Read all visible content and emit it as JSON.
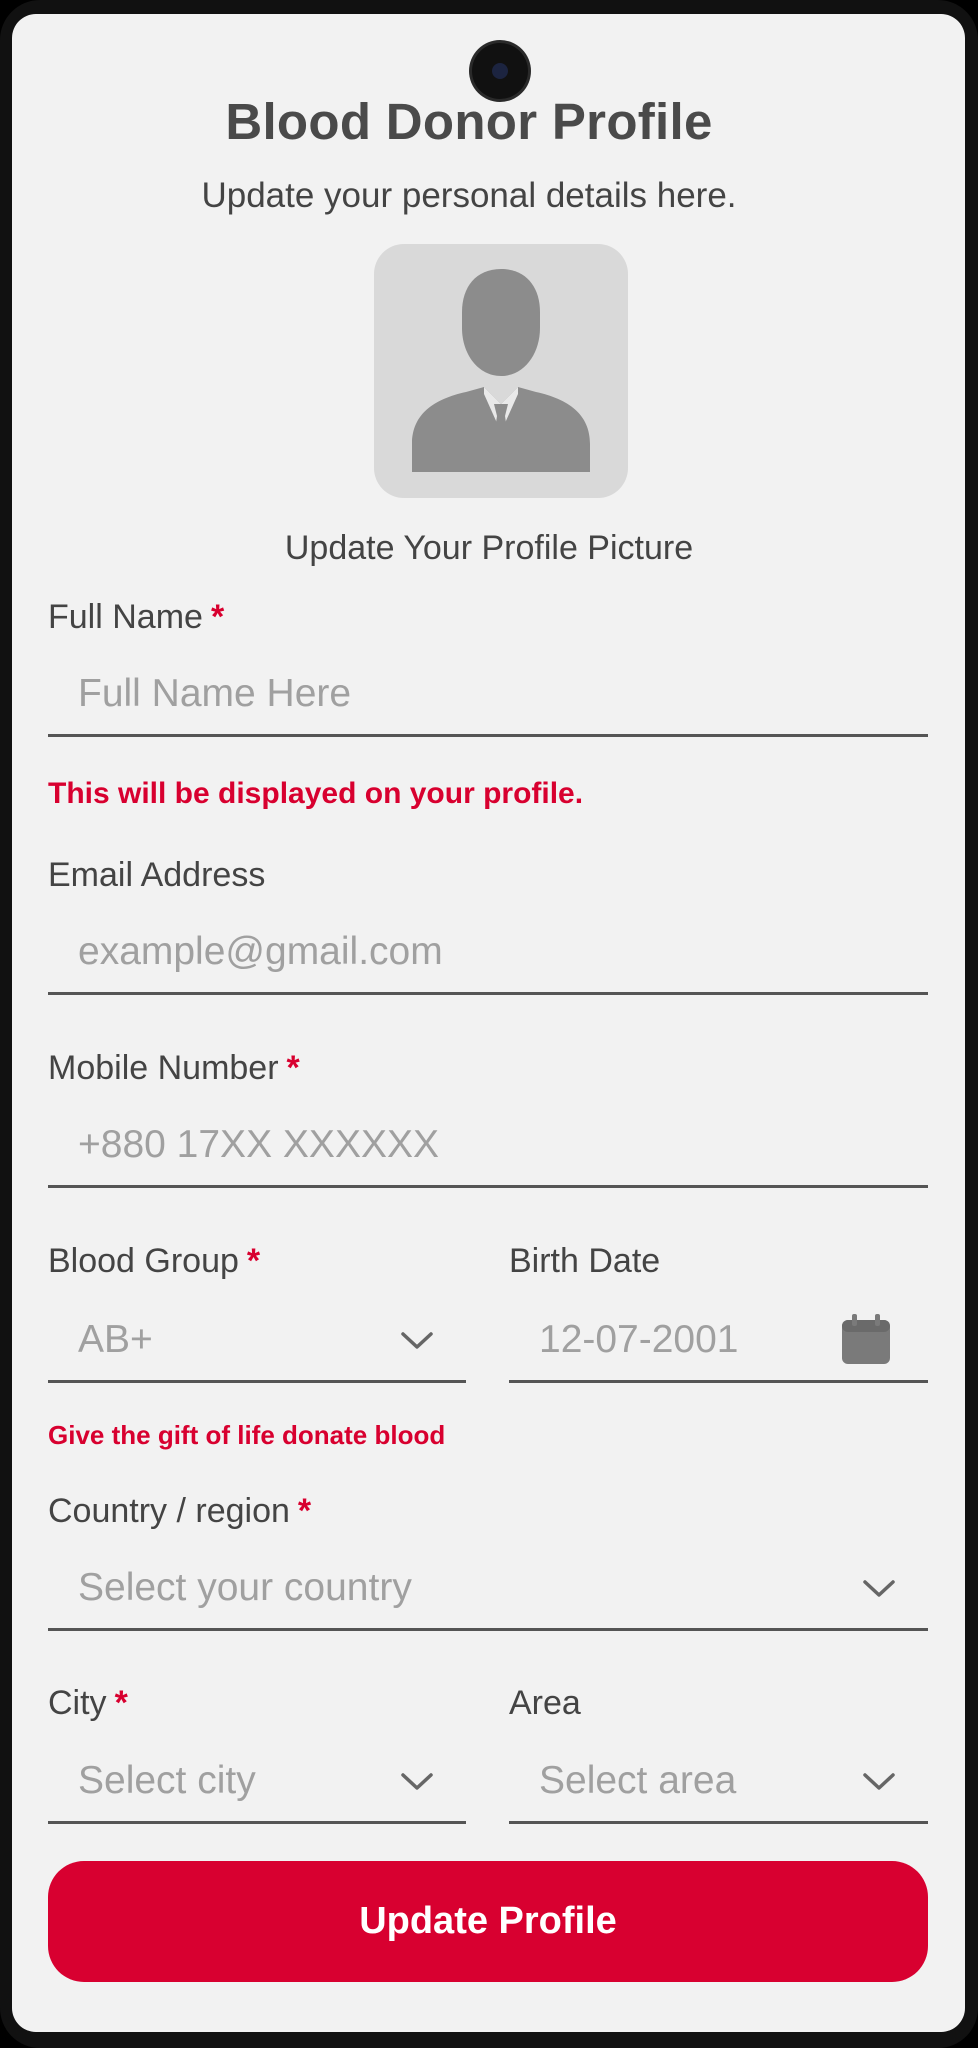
{
  "header": {
    "title": "Blood Donor Profile",
    "subtitle": "Update your personal details here."
  },
  "avatar": {
    "icon": "person-avatar-icon",
    "caption": "Update Your Profile Picture"
  },
  "form": {
    "full_name": {
      "label": "Full Name",
      "required": "*",
      "placeholder": "Full Name Here",
      "help": "This will be displayed on your profile."
    },
    "email": {
      "label": "Email Address",
      "placeholder": "example@gmail.com"
    },
    "mobile": {
      "label": "Mobile Number",
      "required": "*",
      "placeholder": "+880 17XX XXXXXX"
    },
    "blood_group": {
      "label": "Blood Group",
      "required": "*",
      "value": "AB+",
      "help": "Give the gift of life donate blood"
    },
    "birth_date": {
      "label": "Birth Date",
      "value": "12-07-2001"
    },
    "country": {
      "label": "Country / region",
      "required": "*",
      "placeholder": "Select your country"
    },
    "city": {
      "label": "City",
      "required": "*",
      "placeholder": "Select city"
    },
    "area": {
      "label": "Area",
      "placeholder": "Select area"
    }
  },
  "submit": {
    "label": "Update Profile"
  },
  "colors": {
    "accent": "#d80030",
    "background": "#f2f2f2",
    "text": "#444444",
    "placeholder": "#a0a0a0"
  }
}
